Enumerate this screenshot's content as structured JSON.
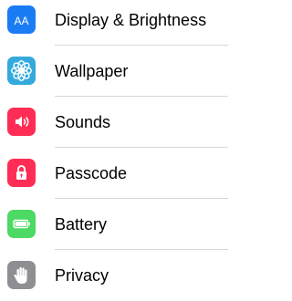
{
  "settings": {
    "items": [
      {
        "label": "Display & Brightness",
        "icon": "display-brightness-icon",
        "color": "#1a7cf5"
      },
      {
        "label": "Wallpaper",
        "icon": "wallpaper-flower-icon",
        "color": "#34aadc"
      },
      {
        "label": "Sounds",
        "icon": "speaker-icon",
        "color": "#ff2d55"
      },
      {
        "label": "Passcode",
        "icon": "lock-icon",
        "color": "#ff2d55"
      },
      {
        "label": "Battery",
        "icon": "battery-icon",
        "color": "#4cd964"
      },
      {
        "label": "Privacy",
        "icon": "hand-icon",
        "color": "#8e8e93"
      }
    ],
    "display_icon_glyph": "AA"
  }
}
